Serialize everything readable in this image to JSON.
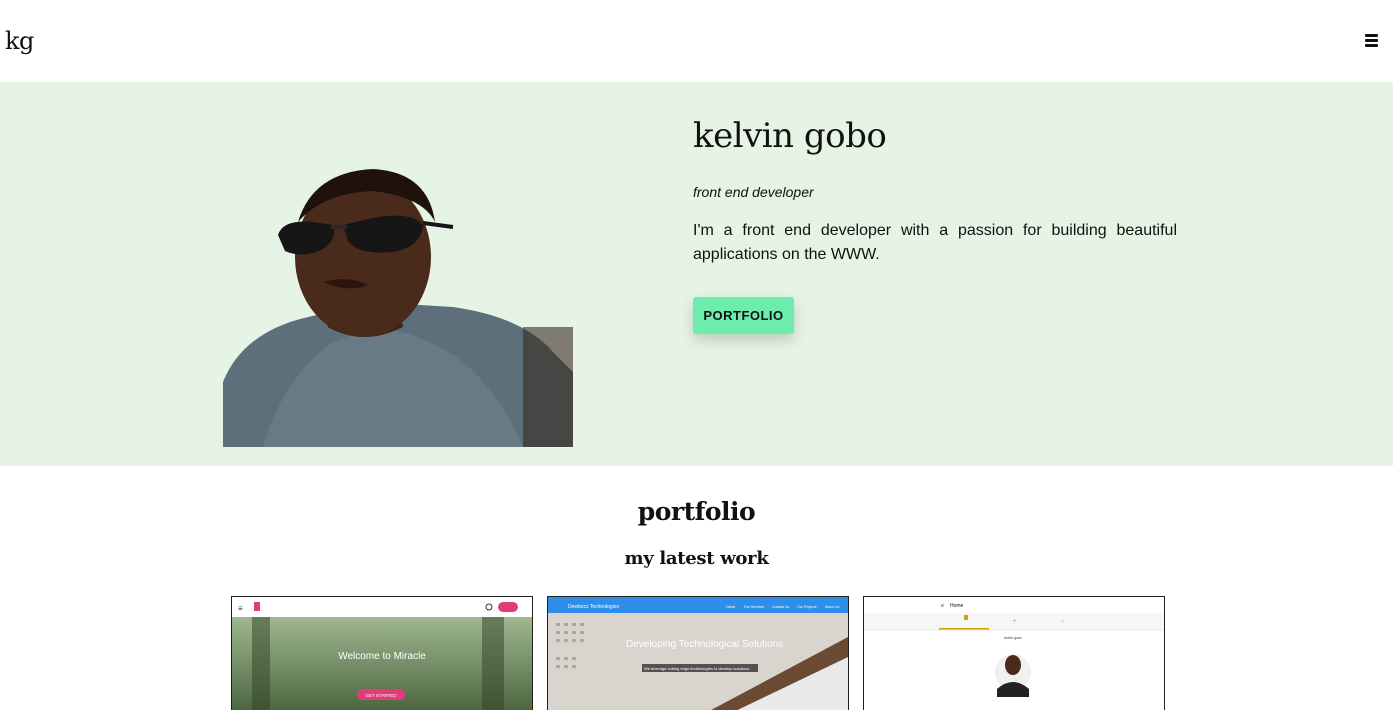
{
  "header": {
    "logo": "kg",
    "menu_icon": "hamburger-menu-icon"
  },
  "hero": {
    "name": "kelvin gobo",
    "role": "front end developer",
    "bio": "I'm a front end developer with a passion for building beautiful applications on the WWW.",
    "cta_label": "PORTFOLIO",
    "colors": {
      "background": "#e6f4e6",
      "cta": "#6cedae"
    }
  },
  "portfolio": {
    "title": "portfolio",
    "subtitle": "my latest work",
    "cards": [
      {
        "heading": "Welcome to Miracle",
        "button": "GET STARTED"
      },
      {
        "brand": "Dewbocs Technologies",
        "nav": [
          "Home",
          "Our Services",
          "Contact Us",
          "Our Projects",
          "About Us"
        ],
        "heading": "Developing Technological Solutions",
        "subheading": "We leverage cutting edge technologies to develop solutions"
      },
      {
        "nav_title": "Home",
        "profile_name": "kelvin gobo"
      }
    ]
  }
}
